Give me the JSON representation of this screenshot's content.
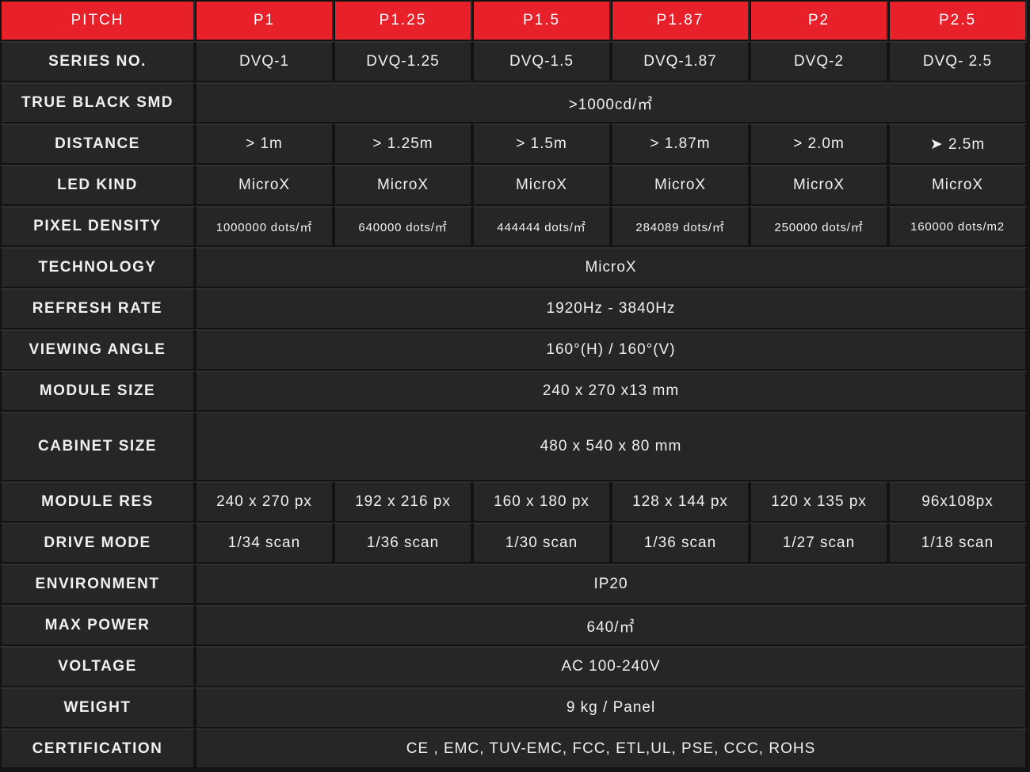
{
  "header": {
    "first_col": "PITCH",
    "pitches": [
      "P1",
      "P1.25",
      "P1.5",
      "P1.87",
      "P2",
      "P2.5"
    ]
  },
  "colors": {
    "header_red": "#e8202a",
    "cell_bg": "#262626",
    "text": "#f0f0f0"
  },
  "rows": {
    "series": {
      "label": "SERIES NO.",
      "values": [
        "DVQ-1",
        "DVQ-1.25",
        "DVQ-1.5",
        "DVQ-1.87",
        "DVQ-2",
        "DVQ- 2.5"
      ]
    },
    "true_black": {
      "label": "TRUE BLACK SMD",
      "value": ">1000cd/㎡"
    },
    "distance": {
      "label": "DISTANCE",
      "values": [
        "> 1m",
        "> 1.25m",
        "> 1.5m",
        "> 1.87m",
        "> 2.0m",
        "➤  2.5m"
      ]
    },
    "led_kind": {
      "label": "LED KIND",
      "values": [
        "MicroX",
        "MicroX",
        "MicroX",
        "MicroX",
        "MicroX",
        "MicroX"
      ]
    },
    "pixel_density": {
      "label": "PIXEL DENSITY",
      "values": [
        "1000000 dots/㎡",
        "640000 dots/㎡",
        "444444 dots/㎡",
        "284089 dots/㎡",
        "250000 dots/㎡",
        "160000 dots/m2"
      ]
    },
    "technology": {
      "label": "TECHNOLOGY",
      "value": "MicroX"
    },
    "refresh_rate": {
      "label": "REFRESH RATE",
      "value": "1920Hz - 3840Hz"
    },
    "viewing_angle": {
      "label": "VIEWING ANGLE",
      "value": "160°(H) / 160°(V)"
    },
    "module_size": {
      "label": "MODULE SIZE",
      "value": "240 x 270 x13 mm"
    },
    "cabinet_size": {
      "label": "CABINET SIZE",
      "value": "480 x 540 x 80 mm"
    },
    "module_res": {
      "label": "MODULE RES",
      "values": [
        "240 x 270 px",
        "192 x 216 px",
        "160 x 180 px",
        "128 x 144 px",
        "120 x 135 px",
        "96x108px"
      ]
    },
    "drive_mode": {
      "label": "DRIVE MODE",
      "values": [
        "1/34 scan",
        "1/36 scan",
        "1/30 scan",
        "1/36 scan",
        "1/27 scan",
        "1/18 scan"
      ]
    },
    "environment": {
      "label": "ENVIRONMENT",
      "value": "IP20"
    },
    "max_power": {
      "label": "MAX POWER",
      "value": "640/㎡"
    },
    "voltage": {
      "label": "VOLTAGE",
      "value": "AC 100-240V"
    },
    "weight": {
      "label": "WEIGHT",
      "value": "9 kg / Panel"
    },
    "certification": {
      "label": "CERTIFICATION",
      "value": "CE , EMC, TUV-EMC, FCC, ETL,UL, PSE, CCC, ROHS"
    }
  }
}
